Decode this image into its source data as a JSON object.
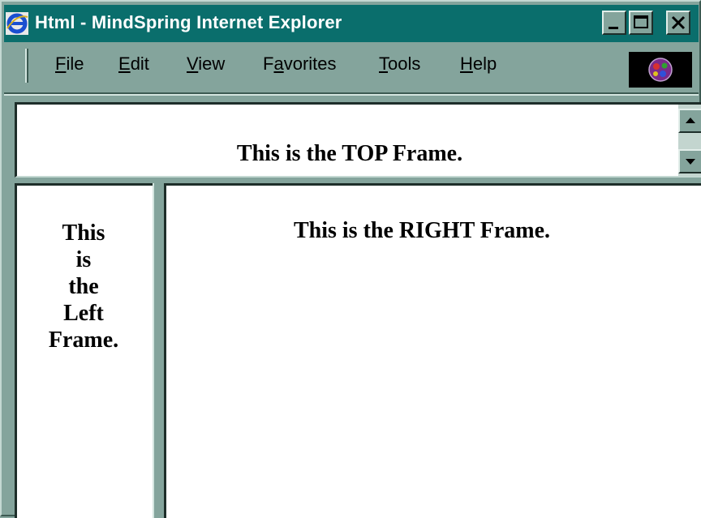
{
  "window": {
    "title": "Html - MindSpring Internet Explorer"
  },
  "menu": {
    "items": [
      {
        "pre": "",
        "key": "F",
        "post": "ile"
      },
      {
        "pre": "",
        "key": "E",
        "post": "dit"
      },
      {
        "pre": "",
        "key": "V",
        "post": "iew"
      },
      {
        "pre": "F",
        "key": "a",
        "post": "vorites"
      },
      {
        "pre": "",
        "key": "T",
        "post": "ools"
      },
      {
        "pre": "",
        "key": "H",
        "post": "elp"
      }
    ]
  },
  "frames": {
    "top": "This is the TOP Frame.",
    "left": [
      "This",
      "is",
      "the",
      "Left",
      "Frame."
    ],
    "right": "This is the RIGHT Frame."
  },
  "colors": {
    "titlebar": "#0a6e6c",
    "chrome": "#84a49c",
    "frame_bg": "#ffffff"
  },
  "icons": {
    "app": "ie-icon",
    "logo": "mindspring-logo",
    "minimize": "minimize-icon",
    "maximize": "maximize-icon",
    "close": "close-icon",
    "scroll_up": "arrow-up-icon",
    "scroll_down": "arrow-down-icon"
  }
}
